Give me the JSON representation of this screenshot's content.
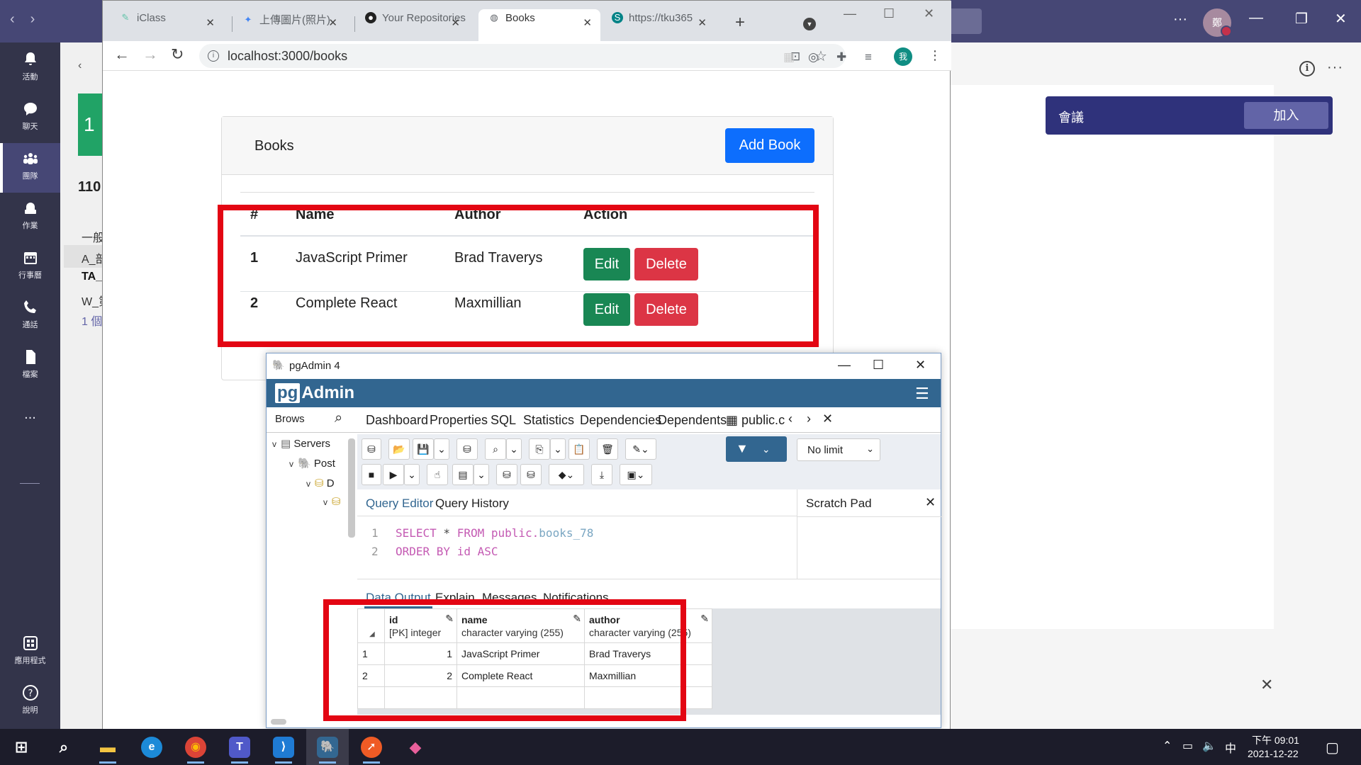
{
  "teams": {
    "rail": [
      {
        "label": "活動",
        "icon": "bell-icon"
      },
      {
        "label": "聊天",
        "icon": "chat-icon"
      },
      {
        "label": "團隊",
        "icon": "teams-icon"
      },
      {
        "label": "作業",
        "icon": "assignments-icon"
      },
      {
        "label": "行事曆",
        "icon": "calendar-icon"
      },
      {
        "label": "通話",
        "icon": "phone-icon"
      },
      {
        "label": "檔案",
        "icon": "file-icon"
      },
      {
        "label": "應用程式",
        "icon": "apps-icon"
      },
      {
        "label": "說明",
        "icon": "help-icon"
      }
    ],
    "more_label": "...",
    "avatar_text": "鄭",
    "left_panel": {
      "team_tile_text": "1",
      "team_name": "110",
      "items": [
        "一般",
        "A_部",
        "TA_",
        "W_第",
        "1 個"
      ]
    },
    "meeting_label": "會議",
    "join_label": "加入"
  },
  "chrome": {
    "tabs": [
      {
        "title": "iClass",
        "icon": "iclass-icon"
      },
      {
        "title": "上傳圖片(照片)",
        "icon": "photos-icon"
      },
      {
        "title": "Your Repositories",
        "icon": "github-icon"
      },
      {
        "title": "Books",
        "icon": "globe-icon"
      },
      {
        "title": "https://tku365",
        "icon": "sharepoint-icon"
      }
    ],
    "url": "localhost:3000/books",
    "profile_text": "我"
  },
  "books": {
    "title": "Books",
    "add_label": "Add Book",
    "headers": [
      "#",
      "Name",
      "Author",
      "Action"
    ],
    "rows": [
      {
        "num": "1",
        "name": "JavaScript Primer",
        "author": "Brad Traverys"
      },
      {
        "num": "2",
        "name": "Complete React",
        "author": "Maxmillian"
      }
    ],
    "edit_label": "Edit",
    "delete_label": "Delete"
  },
  "pgadmin": {
    "window_title": "pgAdmin 4",
    "logo_prefix": "pg",
    "logo_suffix": "Admin",
    "browser_tab": "Brows",
    "main_tabs": [
      "Dashboard",
      "Properties",
      "SQL",
      "Statistics",
      "Dependencies",
      "Dependents",
      "public.c"
    ],
    "tree": [
      "Servers",
      "Post",
      "D"
    ],
    "limit_value": "No limit",
    "query_tabs": [
      "Query Editor",
      "Query History"
    ],
    "scratch_pad": "Scratch Pad",
    "sql": {
      "line1_kw": "SELECT",
      "line1_star": " * ",
      "line1_from": "FROM",
      "line1_schema": " public.",
      "line1_table": "books_78",
      "line2_kw": "ORDER BY",
      "line2_col": " id ",
      "line2_dir": "ASC"
    },
    "result_tabs": [
      "Data Output",
      "Explain",
      "Messages",
      "Notifications"
    ],
    "columns": [
      {
        "name": "id",
        "type": "[PK] integer"
      },
      {
        "name": "name",
        "type": "character varying (255)"
      },
      {
        "name": "author",
        "type": "character varying (255)"
      }
    ],
    "rows": [
      {
        "rn": "1",
        "id": "1",
        "name": "JavaScript Primer",
        "author": "Brad Traverys"
      },
      {
        "rn": "2",
        "id": "2",
        "name": "Complete React",
        "author": "Maxmillian"
      }
    ]
  },
  "taskbar": {
    "apps": [
      {
        "name": "start-icon",
        "glyph": "⊞"
      },
      {
        "name": "search-icon",
        "glyph": "⌕"
      },
      {
        "name": "file-explorer-icon",
        "glyph": "▬"
      },
      {
        "name": "edge-icon",
        "glyph": "e"
      },
      {
        "name": "chrome-icon",
        "glyph": "◉"
      },
      {
        "name": "teams-app-icon",
        "glyph": "T"
      },
      {
        "name": "vscode-icon",
        "glyph": "⟩"
      },
      {
        "name": "pgadmin-app-icon",
        "glyph": "🐘"
      },
      {
        "name": "postman-icon",
        "glyph": "➚"
      },
      {
        "name": "maps-icon",
        "glyph": "◆"
      }
    ],
    "ime": "中",
    "time": "下午 09:01",
    "date": "2021-12-22"
  },
  "colors": {
    "teams_purple": "#464775",
    "primary_blue": "#0d6efd",
    "success_green": "#198754",
    "danger_red": "#dc3545",
    "annotation_red": "#e30613",
    "pgadmin_blue": "#326690"
  }
}
